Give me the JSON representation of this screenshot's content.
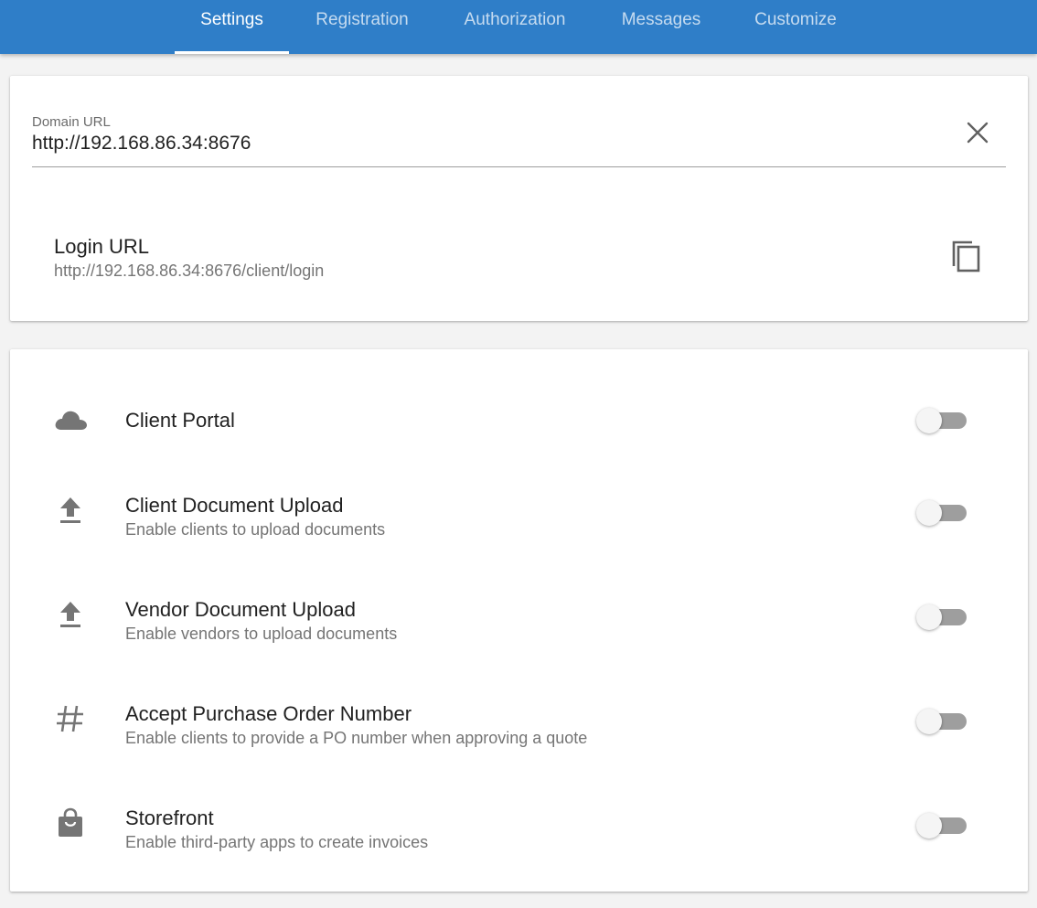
{
  "tabs": [
    {
      "label": "Settings",
      "active": true
    },
    {
      "label": "Registration",
      "active": false
    },
    {
      "label": "Authorization",
      "active": false
    },
    {
      "label": "Messages",
      "active": false
    },
    {
      "label": "Customize",
      "active": false
    }
  ],
  "domain": {
    "label": "Domain URL",
    "value": "http://192.168.86.34:8676"
  },
  "login": {
    "title": "Login URL",
    "value": "http://192.168.86.34:8676/client/login"
  },
  "settings": [
    {
      "title": "Client Portal",
      "subtitle": "",
      "icon": "cloud-icon",
      "enabled": false
    },
    {
      "title": "Client Document Upload",
      "subtitle": "Enable clients to upload documents",
      "icon": "upload-icon",
      "enabled": false
    },
    {
      "title": "Vendor Document Upload",
      "subtitle": "Enable vendors to upload documents",
      "icon": "upload-icon",
      "enabled": false
    },
    {
      "title": "Accept Purchase Order Number",
      "subtitle": "Enable clients to provide a PO number when approving a quote",
      "icon": "hash-icon",
      "enabled": false
    },
    {
      "title": "Storefront",
      "subtitle": "Enable third-party apps to create invoices",
      "icon": "shopping-bag-icon",
      "enabled": false
    }
  ],
  "colors": {
    "primary": "#2f7ec8",
    "icon": "#757575",
    "toggle_track": "#9e9e9e"
  }
}
